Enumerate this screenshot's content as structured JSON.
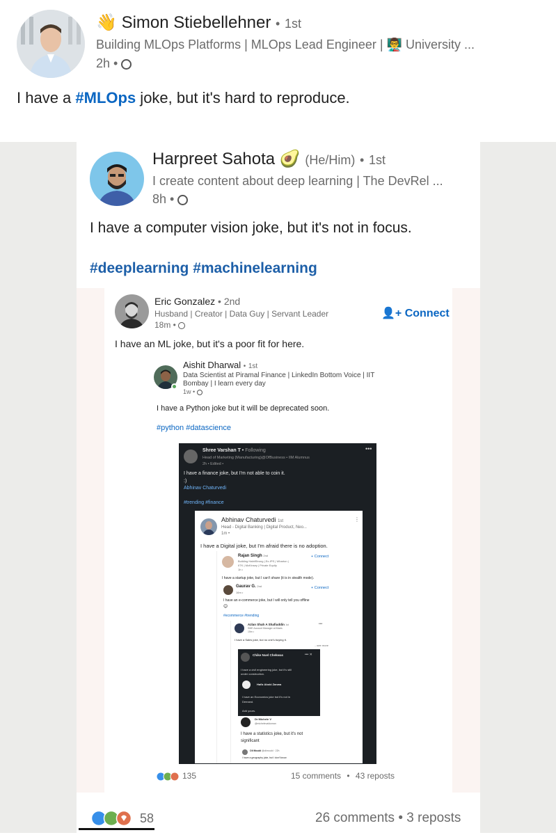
{
  "post": {
    "author": "Simon Stiebellehner",
    "degree": "1st",
    "headline": "Building MLOps Platforms | MLOps Lead Engineer | 👨‍🏫 University ...",
    "time": "2h",
    "text_prefix": "I have a ",
    "hashtag": "#MLOps",
    "text_suffix": " joke, but it's hard to reproduce.",
    "reaction_count": "58",
    "comments": "26 comments",
    "reposts": "3 reposts"
  },
  "repost1": {
    "author": "Harpreet Sahota",
    "author_emoji": "🥑",
    "pronouns": "(He/Him)",
    "degree": "1st",
    "headline": "I create content about deep learning | The DevRel ...",
    "time": "8h",
    "text": "I have a computer vision joke, but it's not in focus.",
    "hashtags": "#deeplearning #machinelearning"
  },
  "repost2": {
    "author": "Eric Gonzalez",
    "degree": "2nd",
    "headline": "Husband | Creator | Data Guy | Servant Leader",
    "time": "18m",
    "connect": "Connect",
    "text": "I have an ML joke, but it's a poor fit for here.",
    "reaction_count": "135",
    "comments": "15 comments",
    "reposts": "43 reposts"
  },
  "repost3": {
    "author": "Aishit Dharwal",
    "degree": "1st",
    "headline1": "Data Scientist at Piramal Finance | LinkedIn Bottom Voice | IIT",
    "headline2": "Bombay | I learn every day",
    "time": "1w",
    "text": "I have a Python joke but it will be deprecated soon.",
    "hashtags": "#python #datascience"
  },
  "repost4": {
    "author": "Shree Varshan T",
    "following": "Following",
    "headline": "Head of Marketing (Manufacturing)@OfBusiness • IIM Alumnus",
    "time": "2h • Edited •",
    "text": "I have a finance joke, but I'm not able to coin it.",
    "emoji_line": ":)",
    "mention": "Abhinav Chaturvedi",
    "hashtags": "#trending #finance"
  },
  "repost5": {
    "author": "Abhinav Chaturvedi",
    "degree": "1st",
    "headline": "Head - Digital Banking | Digital Product, Neo...",
    "time": "1m •",
    "text": "I have a Digital joke, but I'm afraid there is no adoption."
  },
  "repost6": {
    "author": "Rajan Singh",
    "degree": "2nd",
    "headline1": "Building HabitStrong | Ex-IPS | Wharton |",
    "headline2": "IITK | McKinsey | Private Equity",
    "time": "1h •",
    "connect": "Connect",
    "text": "I have a startup joke, but I can't share (it is in stealth mode)."
  },
  "repost7": {
    "author": "Gaurav G.",
    "degree": "2nd",
    "time": "16m •",
    "connect": "Connect",
    "text": "I have an e-commerce joke, but I will only tell you offline",
    "hashtags": "#ecommerce #trending"
  },
  "repost8": {
    "author": "Azlan Shah A Shafiuddin",
    "degree": "1st",
    "headline": "SME Account Manager at Maxis",
    "time": "15m •",
    "text": "I have a Sales joke, but no one's buying it.",
    "see_more": "...see more"
  },
  "repost9": {
    "author": "Chike Nuel Chekwas",
    "text1": "I have a civil engineering joke, but it's still",
    "text2": "under construction."
  },
  "repost10": {
    "author": "Hafiz Aboki Zanwa",
    "text1": "I have an Economics joke but it's not in",
    "text2": "Demand.",
    "text3": "Add yours."
  },
  "repost11": {
    "author": "Dr Michele V",
    "handle": "@michelevaldoman",
    "text1": "I have a statistics joke, but it's not",
    "text2": "significant"
  },
  "repost12": {
    "author": "Oli Mould",
    "handle": "@olimould · 22h",
    "text": "I have a geography joke, but I don't know"
  },
  "colors": {
    "link_blue": "#0a66c2",
    "hashtag_blue": "#1d5fa8",
    "dark_frame": "#1b1f23"
  }
}
